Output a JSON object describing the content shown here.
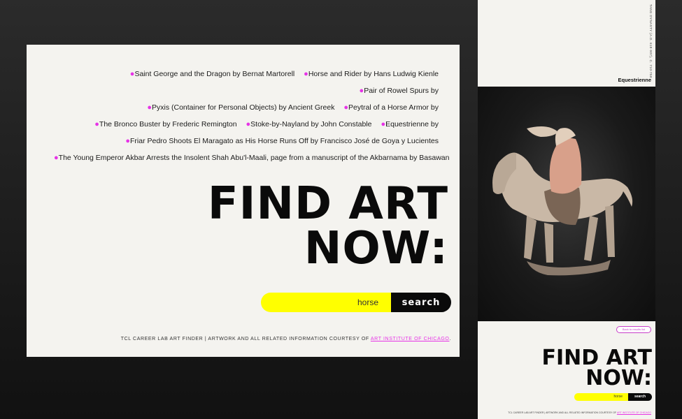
{
  "desktop": {
    "results": [
      "Saint George and the Dragon by Bernat Martorell",
      "Horse and Rider by Hans Ludwig Kienle",
      "Pair of Rowel Spurs by",
      "Pyxis (Container for Personal Objects) by Ancient Greek",
      "Peytral of a Horse Armor by",
      "The Bronco Buster by Frederic Remington",
      "Stoke-by-Nayland by John Constable",
      "Equestrienne by",
      "Friar Pedro Shoots El Maragato as His Horse Runs Off by Francisco José de Goya y Lucientes",
      "The Young Emperor Akbar Arrests the Insolent Shah Abu'l-Maali, page from a manuscript of the Akbarnama by Basawan"
    ],
    "headline_line1": "FIND ART",
    "headline_line2": "NOW:",
    "search_value": "horse",
    "search_button": "search",
    "footer_text": "TCL CAREER LAB ART FINDER | ARTWORK AND ALL RELATED INFORMATION COURTESY OF ",
    "footer_link": "ART INSTITUTE OF CHICAGO",
    "footer_end": "."
  },
  "mobile": {
    "meta": "TANG DYNASTY (A.D. 618-907), C. 710-750",
    "artwork_title": "Equestrienne",
    "back_button": "Back to results list",
    "headline_line1": "FIND ART",
    "headline_line2": "NOW:",
    "search_value": "horse",
    "search_button": "search",
    "footer_text": "TCL CAREER LAB ART FINDER | ARTWORK AND ALL RELATED INFORMATION COURTESY OF ",
    "footer_link": "ART INSTITUTE OF CHICAGO"
  },
  "colors": {
    "accent_magenta": "#e633e6",
    "search_yellow": "#ffff00",
    "ink": "#0a0a0a",
    "paper": "#f4f3ef"
  }
}
